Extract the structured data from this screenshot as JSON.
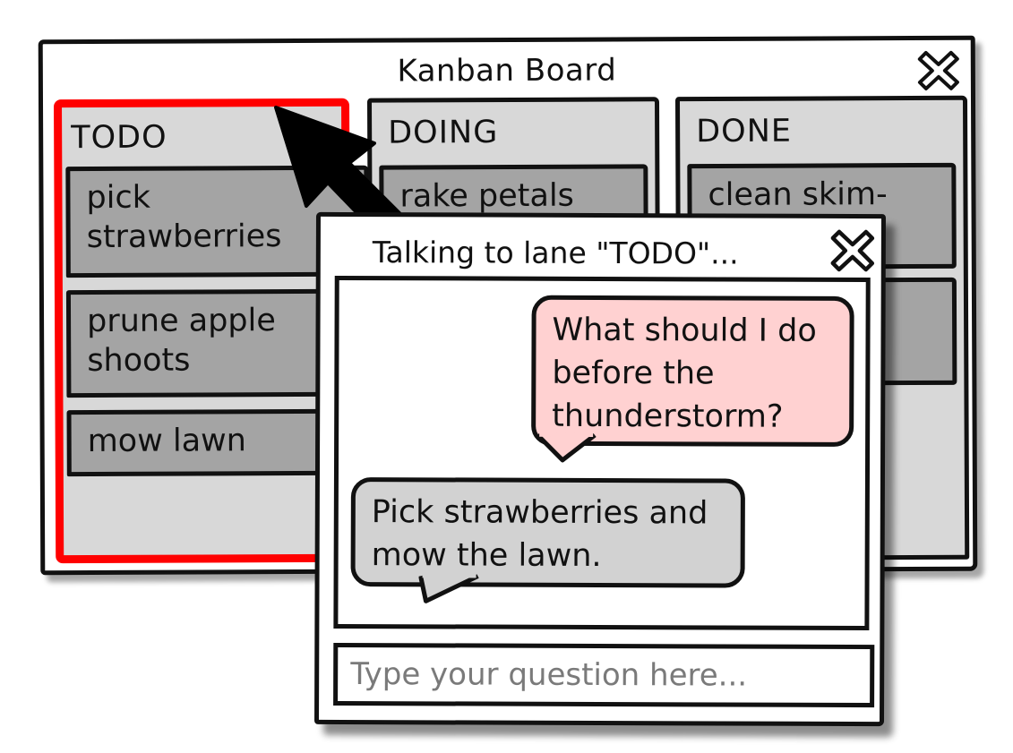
{
  "main_window": {
    "title": "Kanban Board",
    "close_icon": "close-x-icon"
  },
  "lanes": [
    {
      "title": "TODO",
      "highlighted": true,
      "cards": [
        "pick strawberries",
        "prune apple shoots",
        "mow lawn"
      ]
    },
    {
      "title": "DOING",
      "highlighted": false,
      "cards": [
        "rake petals"
      ]
    },
    {
      "title": "DONE",
      "highlighted": false,
      "cards": [
        "clean skim-"
      ]
    }
  ],
  "chat_dialog": {
    "title": "Talking to lane \"TODO\"...",
    "close_icon": "close-x-icon",
    "messages": [
      {
        "role": "user",
        "text": "What should I do before the thunderstorm?"
      },
      {
        "role": "assistant",
        "text": "Pick strawberries and mow the lawn."
      }
    ],
    "input": {
      "value": "",
      "placeholder": "Type your question here..."
    }
  },
  "colors": {
    "highlight": "#ff0000",
    "lane_bg": "#d8d8d8",
    "card_bg": "#a4a4a4",
    "user_bubble": "#ffd1d1",
    "assistant_bubble": "#d2d2d2",
    "outline": "#111111"
  }
}
